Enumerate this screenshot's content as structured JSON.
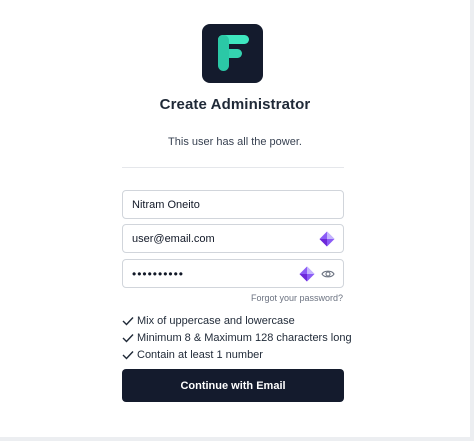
{
  "header": {
    "logo_icon": "f-logo-icon",
    "title": "Create Administrator",
    "subtitle": "This user has all the power."
  },
  "form": {
    "name_value": "Nitram Oneito",
    "email_value": "user@email.com",
    "password_value": "••••••••••",
    "password_manager_icon": "diamond-extension-icon",
    "visibility_icon": "eye-icon",
    "forgot_label": "Forgot your password?"
  },
  "requirements": [
    "Mix of uppercase and lowercase",
    "Minimum 8 & Maximum 128 characters long",
    "Contain at least 1 number"
  ],
  "cta": {
    "label": "Continue with Email"
  },
  "colors": {
    "brand_dark": "#141b2d",
    "logo_accent": "#3ee6bf",
    "extension_purple": "#8b5cf6"
  }
}
